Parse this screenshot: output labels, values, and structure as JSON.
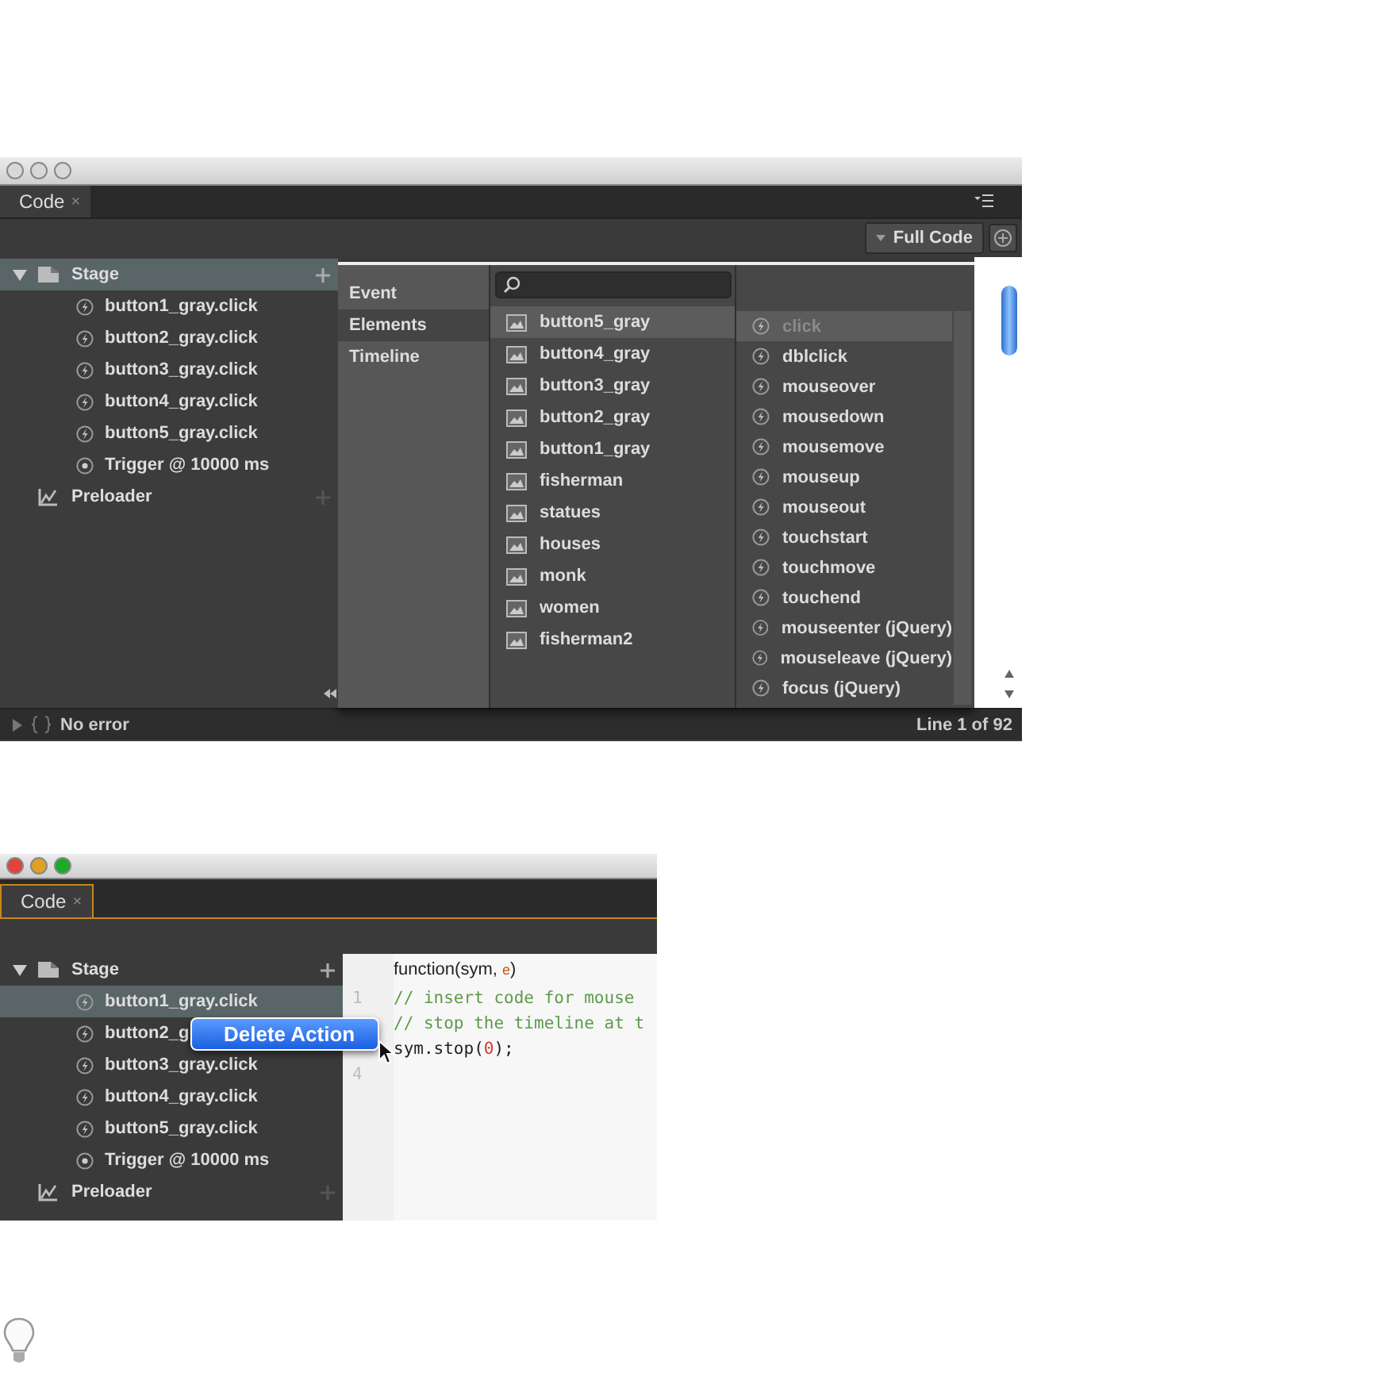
{
  "event_menu_view": {
    "window": {
      "active": false
    },
    "tab": {
      "label": "Code",
      "close": "×"
    },
    "toolbar": {
      "full_code_button": "Full Code"
    },
    "tree": [
      {
        "label": "Stage",
        "kind": "stage",
        "expanded": true,
        "selected": true,
        "children": [
          {
            "label": "button1_gray.click",
            "kind": "action",
            "selected": false
          },
          {
            "label": "button2_gray.click",
            "kind": "action",
            "selected": false
          },
          {
            "label": "button3_gray.click",
            "kind": "action",
            "selected": false
          },
          {
            "label": "button4_gray.click",
            "kind": "action",
            "selected": false
          },
          {
            "label": "button5_gray.click",
            "kind": "action",
            "selected": false
          },
          {
            "label": "Trigger @ 10000 ms",
            "kind": "trigger",
            "selected": false
          }
        ]
      },
      {
        "label": "Preloader",
        "kind": "preloader",
        "selected": false
      }
    ],
    "picker": {
      "categories": [
        {
          "label": "Event",
          "selected": false
        },
        {
          "label": "Elements",
          "selected": true
        },
        {
          "label": "Timeline",
          "selected": false
        }
      ],
      "elements": [
        {
          "label": "button5_gray",
          "selected": true
        },
        {
          "label": "button4_gray",
          "selected": false
        },
        {
          "label": "button3_gray",
          "selected": false
        },
        {
          "label": "button2_gray",
          "selected": false
        },
        {
          "label": "button1_gray",
          "selected": false
        },
        {
          "label": "fisherman",
          "selected": false
        },
        {
          "label": "statues",
          "selected": false
        },
        {
          "label": "houses",
          "selected": false
        },
        {
          "label": "monk",
          "selected": false
        },
        {
          "label": "women",
          "selected": false
        },
        {
          "label": "fisherman2",
          "selected": false
        }
      ],
      "events": [
        {
          "label": "click",
          "selected": true,
          "disabled": true
        },
        {
          "label": "dblclick",
          "selected": false,
          "disabled": false
        },
        {
          "label": "mouseover",
          "selected": false,
          "disabled": false
        },
        {
          "label": "mousedown",
          "selected": false,
          "disabled": false
        },
        {
          "label": "mousemove",
          "selected": false,
          "disabled": false
        },
        {
          "label": "mouseup",
          "selected": false,
          "disabled": false
        },
        {
          "label": "mouseout",
          "selected": false,
          "disabled": false
        },
        {
          "label": "touchstart",
          "selected": false,
          "disabled": false
        },
        {
          "label": "touchmove",
          "selected": false,
          "disabled": false
        },
        {
          "label": "touchend",
          "selected": false,
          "disabled": false
        },
        {
          "label": "mouseenter (jQuery)",
          "selected": false,
          "disabled": false
        },
        {
          "label": "mouseleave (jQuery)",
          "selected": false,
          "disabled": false
        },
        {
          "label": "focus (jQuery)",
          "selected": false,
          "disabled": false
        }
      ]
    },
    "status_bar": {
      "message": "No error",
      "position": "Line 1 of 92"
    }
  },
  "delete_action_view": {
    "window": {
      "active": true
    },
    "tab": {
      "label": "Code",
      "close": "×"
    },
    "tree": [
      {
        "label": "Stage",
        "kind": "stage",
        "expanded": true,
        "selected": false,
        "children": [
          {
            "label": "button1_gray.click",
            "kind": "action",
            "selected": true
          },
          {
            "label": "button2_g",
            "kind": "action",
            "selected": false
          },
          {
            "label": "button3_gray.click",
            "kind": "action",
            "selected": false
          },
          {
            "label": "button4_gray.click",
            "kind": "action",
            "selected": false
          },
          {
            "label": "button5_gray.click",
            "kind": "action",
            "selected": false
          },
          {
            "label": "Trigger @ 10000 ms",
            "kind": "trigger",
            "selected": false
          }
        ]
      },
      {
        "label": "Preloader",
        "kind": "preloader",
        "selected": false
      }
    ],
    "code": {
      "header": {
        "prefix": "function(sym, ",
        "param": "e",
        "suffix": ")"
      },
      "lines": [
        {
          "number": "1",
          "segments": [
            {
              "kind": "comment",
              "text": "// insert code for mouse"
            }
          ]
        },
        {
          "segments": [
            {
              "kind": "comment",
              "text": "// stop the timeline at t"
            }
          ]
        },
        {
          "segments": [
            {
              "kind": "plain",
              "text": "sym.stop("
            },
            {
              "kind": "number",
              "text": "0"
            },
            {
              "kind": "plain",
              "text": ");"
            }
          ]
        },
        {
          "number": "4"
        }
      ]
    },
    "context_menu": {
      "items": [
        {
          "label": "Delete Action",
          "selected": true
        }
      ]
    }
  }
}
